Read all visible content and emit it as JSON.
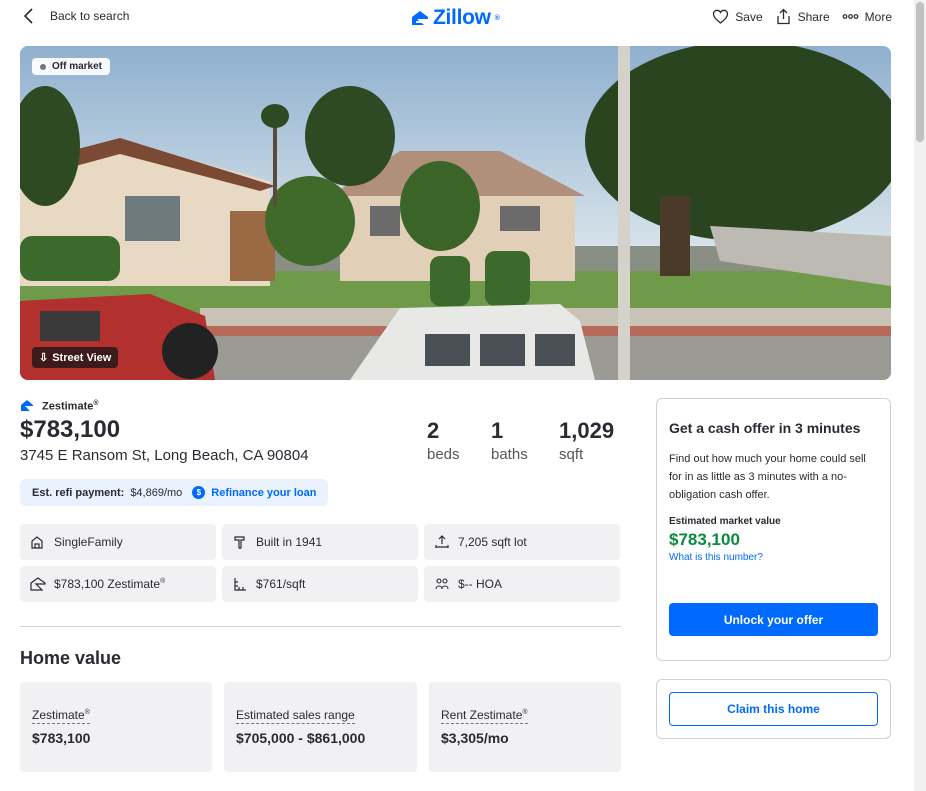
{
  "header": {
    "back_label": "Back to search",
    "logo_text": "Zillow",
    "logo_mark": "®",
    "save_label": "Save",
    "share_label": "Share",
    "more_label": "More"
  },
  "photo": {
    "status_badge": "Off market",
    "street_view_label": "Street View"
  },
  "summary": {
    "zestimate_label": "Zestimate",
    "zestimate_mark": "®",
    "price": "$783,100",
    "address": "3745 E Ransom St, Long Beach, CA 90804",
    "beds_value": "2",
    "beds_label": "beds",
    "baths_value": "1",
    "baths_label": "baths",
    "sqft_value": "1,029",
    "sqft_label": "sqft"
  },
  "refi": {
    "label": "Est. refi payment:",
    "amount": "$4,869/mo",
    "icon_text": "$",
    "link": "Refinance your loan"
  },
  "facts": [
    {
      "text": "SingleFamily",
      "icon": "home-type-icon"
    },
    {
      "text": "Built in 1941",
      "icon": "hammer-icon"
    },
    {
      "text": "7,205 sqft lot",
      "icon": "lot-icon"
    },
    {
      "text": "$783,100 Zestimate",
      "mark": "®",
      "icon": "zestimate-icon"
    },
    {
      "text": "$761/sqft",
      "icon": "ruler-icon"
    },
    {
      "text": "$-- HOA",
      "icon": "hoa-icon"
    }
  ],
  "home_value": {
    "title": "Home value",
    "cards": [
      {
        "label": "Zestimate",
        "mark": "®",
        "value": "$783,100"
      },
      {
        "label": "Estimated sales range",
        "value": "$705,000 - $861,000"
      },
      {
        "label": "Rent Zestimate",
        "mark": "®",
        "value": "$3,305/mo"
      }
    ]
  },
  "cash_offer": {
    "title": "Get a cash offer in 3 minutes",
    "description": "Find out how much your home could sell for in as little as 3 minutes with a no-obligation cash offer.",
    "market_value_label": "Estimated market value",
    "market_value": "$783,100",
    "what_link": "What is this number?",
    "button": "Unlock your offer"
  },
  "claim": {
    "button": "Claim this home"
  },
  "colors": {
    "brand_blue": "#006aff",
    "value_green": "#0c8a3e",
    "text": "#2a2a33"
  }
}
